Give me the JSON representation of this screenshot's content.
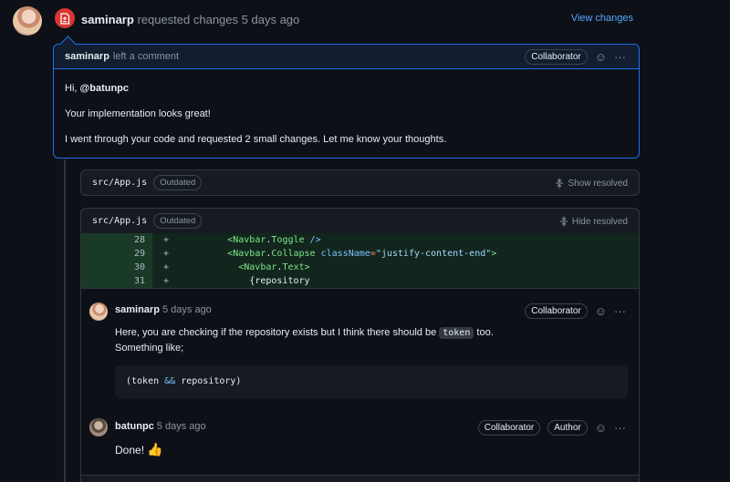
{
  "review": {
    "author": "saminarp",
    "action": "requested changes",
    "time": "5 days ago",
    "view_changes": "View changes",
    "comment": {
      "author": "saminarp",
      "action": "left a comment",
      "role": "Collaborator",
      "greeting_prefix": "Hi, ",
      "mention": "@batunpc",
      "line2": "Your implementation looks great!",
      "line3": "I went through your code and requested 2 small changes. Let me know your thoughts."
    }
  },
  "files": [
    {
      "path": "src/App.js",
      "status": "Outdated",
      "resolve": "Show resolved"
    },
    {
      "path": "src/App.js",
      "status": "Outdated",
      "resolve": "Hide resolved"
    }
  ],
  "diff": [
    {
      "num": "28",
      "sign": "+",
      "indent": "          ",
      "tag": "<Navbar",
      "dot": ".",
      "comp": "Toggle",
      "rest": " />"
    },
    {
      "num": "29",
      "sign": "+",
      "indent": "          ",
      "tag": "<Navbar",
      "dot": ".",
      "comp": "Collapse",
      "attr": " className",
      "eq": "=",
      "str": "\"justify-content-end\"",
      "rest": ">"
    },
    {
      "num": "30",
      "sign": "+",
      "indent": "            ",
      "tag": "<Navbar",
      "dot": ".",
      "comp": "Text",
      "rest": ">"
    },
    {
      "num": "31",
      "sign": "+",
      "indent": "              ",
      "text": "{repository"
    }
  ],
  "thread": [
    {
      "author": "saminarp",
      "time": "5 days ago",
      "role": "Collaborator",
      "text_before": "Here, you are checking if the repository exists but I think there should be ",
      "code": "token",
      "text_after": " too.",
      "line2": "Something like;",
      "block_a": "(token ",
      "block_op": "&&",
      "block_b": " repository)"
    },
    {
      "author": "batunpc",
      "time": "5 days ago",
      "role": "Collaborator",
      "role2": "Author",
      "text": "Done! ",
      "emoji": "👍"
    }
  ],
  "icons": {
    "smiley": "☺",
    "more": "···"
  },
  "colors": {
    "accent": "#1f6feb",
    "danger": "#da3633",
    "link": "#58a6ff",
    "added_bg": "#12261e"
  }
}
